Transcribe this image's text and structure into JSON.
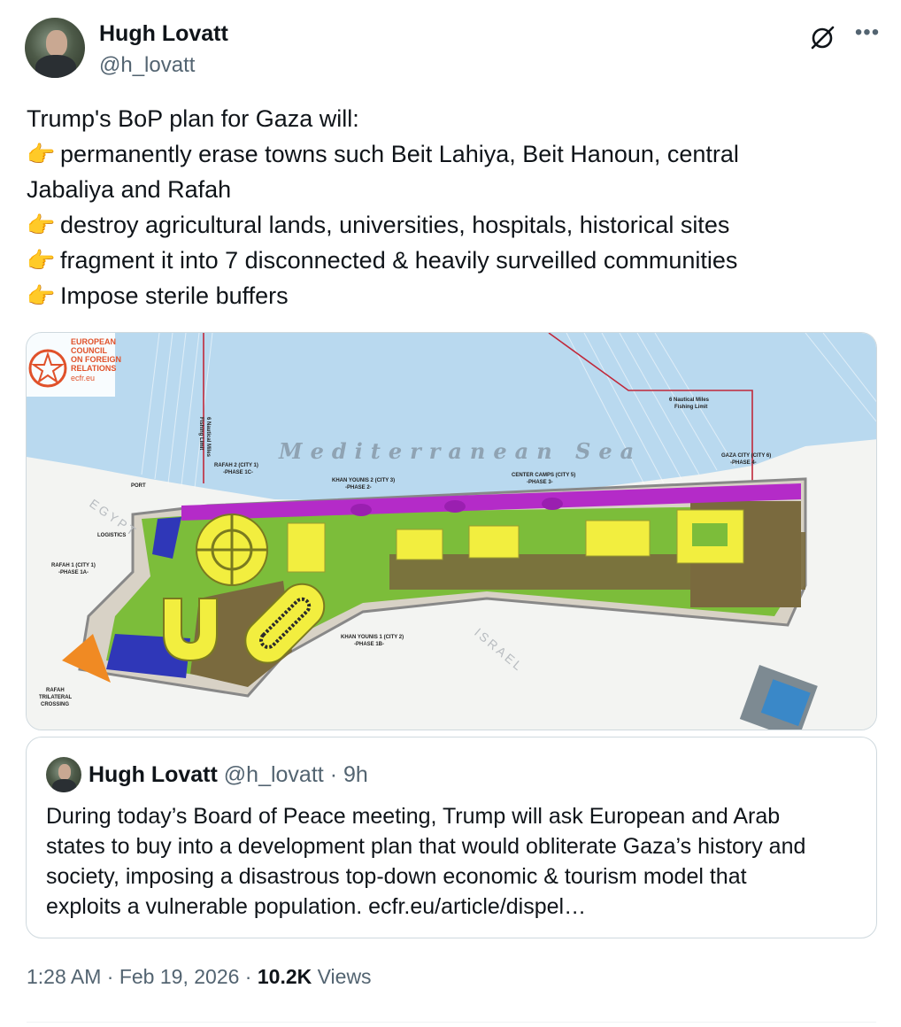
{
  "author": {
    "name": "Hugh Lovatt",
    "handle": "@h_lovatt"
  },
  "icons": [
    "grok-icon",
    "more-icon",
    "pointing-hand-icon"
  ],
  "tweet": {
    "point_icon": "👉",
    "lines": [
      "Trump's BoP plan for Gaza will:",
      "permanently erase towns such Beit Lahiya, Beit Hanoun, central",
      "Jabaliya and Rafah",
      "destroy agricultural lands, universities, hospitals, historical sites",
      "fragment it into 7 disconnected & heavily surveilled communities",
      "Impose sterile buffers"
    ]
  },
  "media": {
    "logo_lines": [
      "EUROPEAN",
      "COUNCIL",
      "ON FOREIGN",
      "RELATIONS",
      "ecfr.eu"
    ],
    "sea_label": "Mediterranean Sea",
    "map_labels": {
      "fishing_left": [
        "6 Nautical Miles",
        "Fishing Limit"
      ],
      "fishing_right": [
        "6 Nautical Miles",
        "Fishing Limit"
      ],
      "rafah_city": [
        "RAFAH 2 (CITY 1)",
        "-PHASE 1C-"
      ],
      "khan_younis_2": [
        "KHAN YOUNIS 2 (CITY 3)",
        "-PHASE 2-"
      ],
      "center_camps": [
        "CENTER CAMPS (CITY 5)",
        "-PHASE 3-"
      ],
      "gaza_city": [
        "GAZA CITY (CITY 6)",
        "-PHASE 4-"
      ],
      "port": "PORT",
      "logistics": "LOGISTICS",
      "egypt": "EGYPT",
      "rafah_1": [
        "RAFAH 1 (CITY 1)",
        "-PHASE 1A-"
      ],
      "khan_younis_1": [
        "KHAN YOUNIS 1 (CITY 2)",
        "-PHASE 1B-"
      ],
      "crossing": [
        "RAFAH",
        "TRILATERAL",
        "CROSSING"
      ],
      "israel": "ISRAEL"
    },
    "colors": {
      "sea": "#b9d9ef",
      "agri": "#7cbd3a",
      "residential": "#f2ee3f",
      "industrial": "#7a6a3e",
      "coastal": "#b42bc8",
      "buffer": "#2f37b8",
      "orange": "#f08a23"
    }
  },
  "quote": {
    "name": "Hugh Lovatt",
    "handle": "@h_lovatt",
    "separator": "·",
    "time": "9h",
    "lines": [
      "During today’s Board of Peace meeting, Trump will ask European and Arab",
      "states  to buy into a development plan that would obliterate Gaza’s history and",
      "society, imposing a disastrous top-down economic & tourism model that",
      "exploits a vulnerable population. ecfr.eu/article/dispel…"
    ]
  },
  "meta": {
    "time": "1:28 AM",
    "date": "Feb 19, 2026",
    "separator": "·",
    "views_count": "10.2K",
    "views_label": "Views"
  }
}
